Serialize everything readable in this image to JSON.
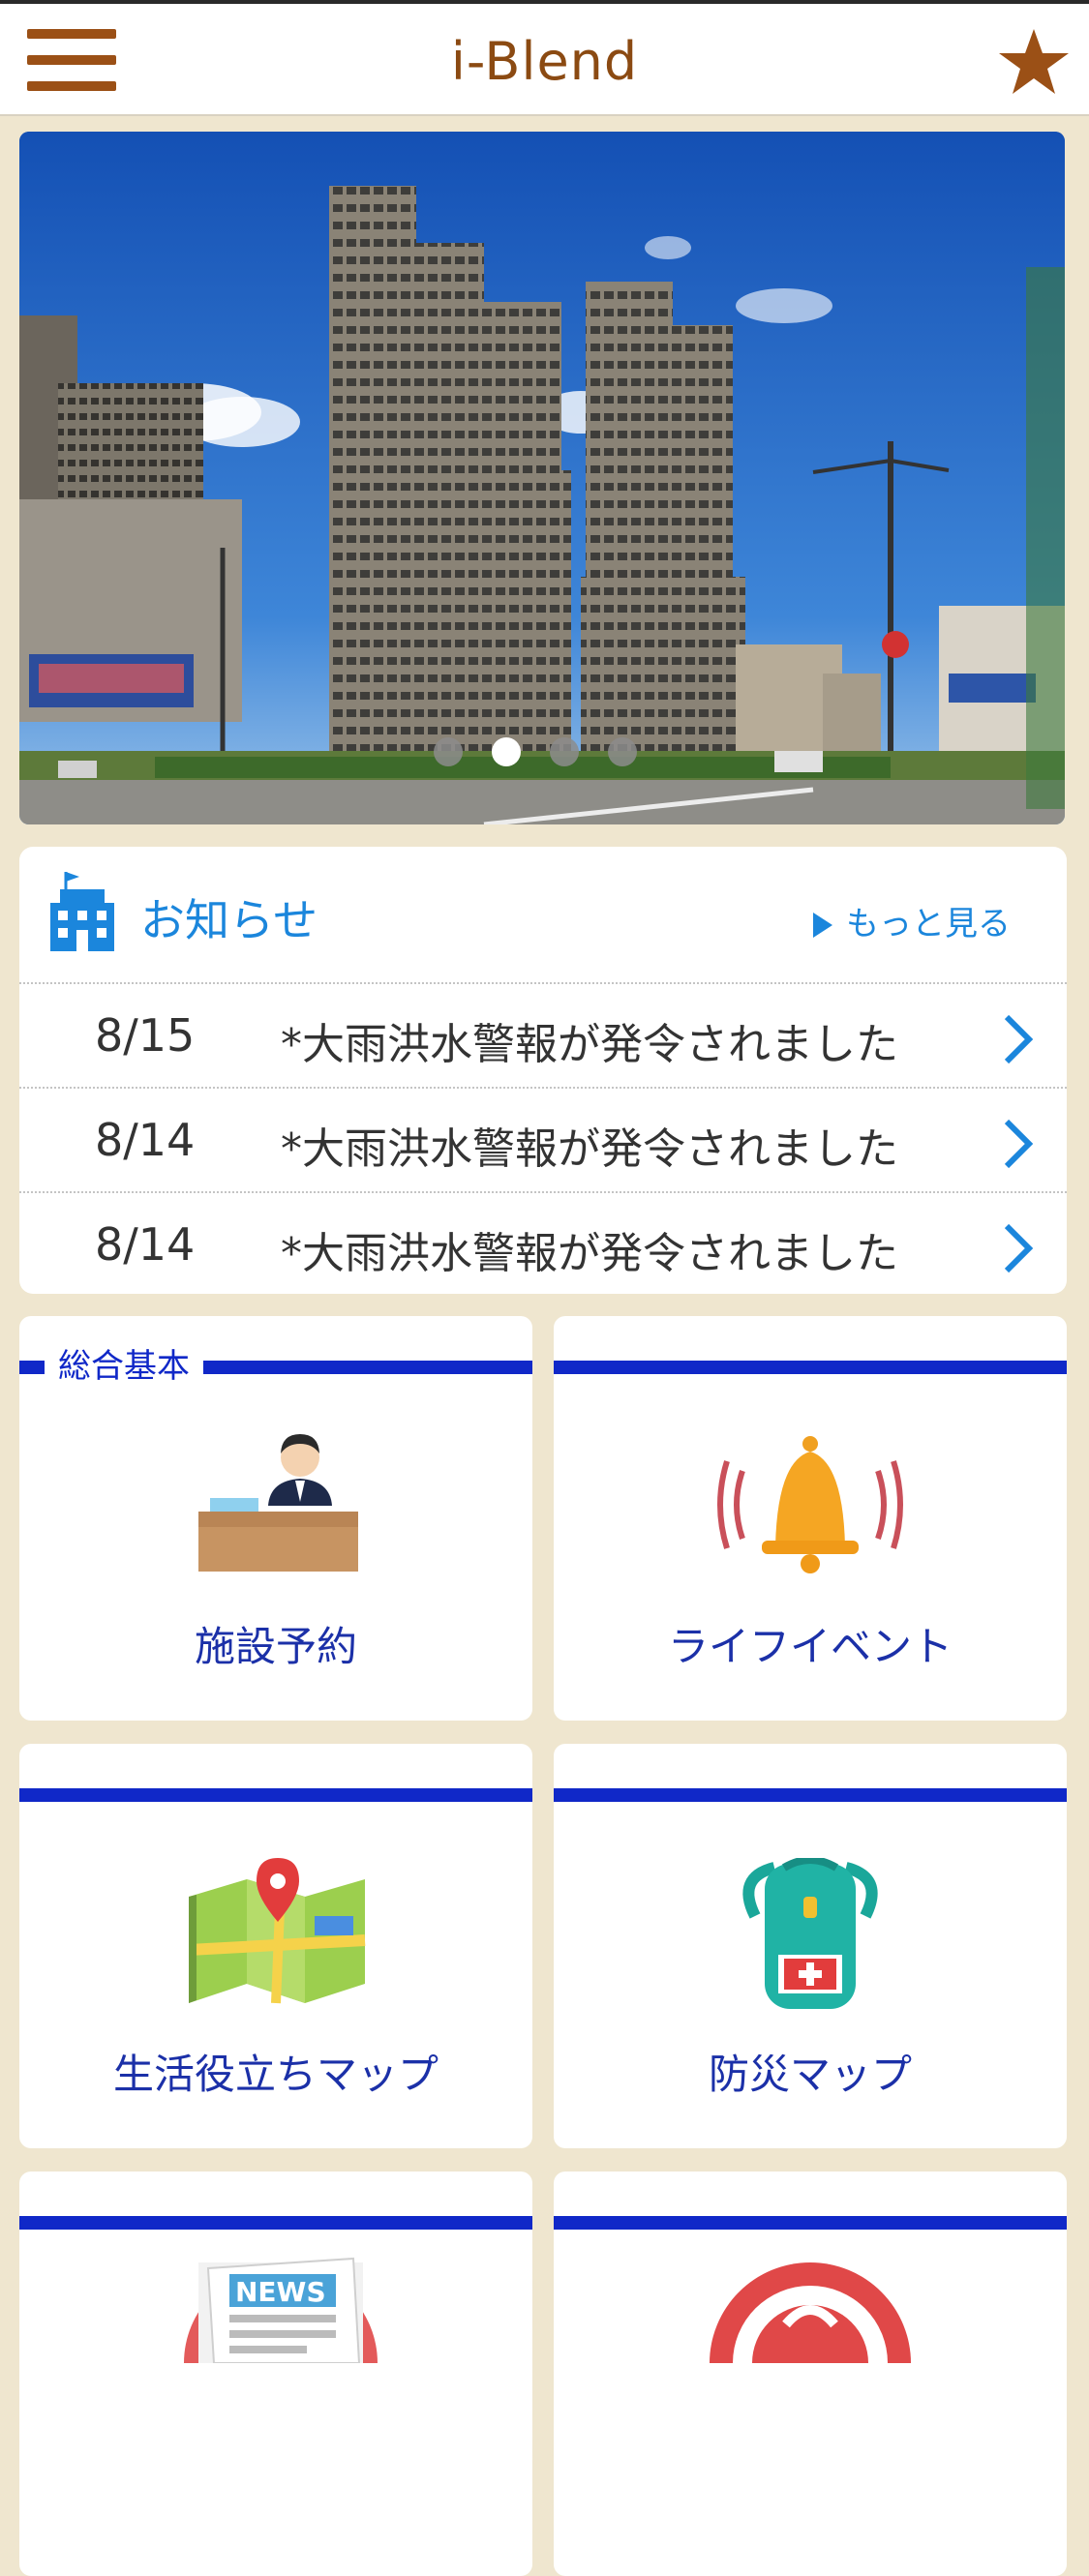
{
  "header": {
    "title": "i-Blend",
    "menu_icon": "hamburger-menu-icon",
    "favorite_icon": "star-icon",
    "brand_color": "#9b5016"
  },
  "carousel": {
    "slide_count": 4,
    "active_index": 1
  },
  "news": {
    "title": "お知らせ",
    "more_label": "もっと見る",
    "items": [
      {
        "date": "8/15",
        "text": "*大雨洪水警報が発令されました"
      },
      {
        "date": "8/14",
        "text": "*大雨洪水警報が発令されました"
      },
      {
        "date": "8/14",
        "text": "*大雨洪水警報が発令されました"
      }
    ]
  },
  "section": {
    "label": "総合基本",
    "accent": "#1028c8"
  },
  "tiles": [
    {
      "label": "施設予約",
      "icon": "reception-desk-icon"
    },
    {
      "label": "ライフイベント",
      "icon": "bell-icon"
    },
    {
      "label": "生活役立ちマップ",
      "icon": "map-pin-icon"
    },
    {
      "label": "防災マップ",
      "icon": "emergency-backpack-icon"
    },
    {
      "label": "",
      "icon": "newspaper-icon"
    },
    {
      "label": "",
      "icon": "badge-icon"
    }
  ]
}
